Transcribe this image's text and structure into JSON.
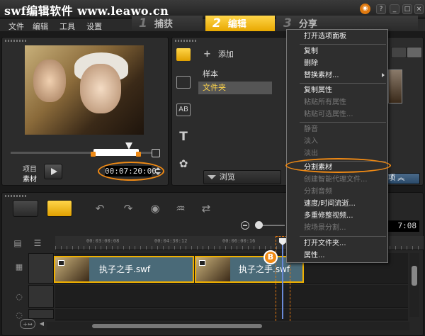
{
  "window": {
    "title": "swf编辑软件 www.leawo.cn"
  },
  "menu": {
    "items": [
      "文件",
      "编辑",
      "工具",
      "设置"
    ]
  },
  "steps": [
    {
      "num": "1",
      "label": "捕获"
    },
    {
      "num": "2",
      "label": "编辑"
    },
    {
      "num": "3",
      "label": "分享"
    }
  ],
  "player": {
    "labels": {
      "project": "项目",
      "clip": "素材"
    },
    "timecode": "00:07:20:00"
  },
  "library": {
    "add_label": "添加",
    "items": [
      {
        "label": "样本"
      },
      {
        "label": "文件夹"
      }
    ],
    "browse_label": "浏览",
    "options_label": "选项"
  },
  "timeline": {
    "ruler": [
      "00:03:00:08",
      "00:04:30:12",
      "00:06:00:16"
    ],
    "duration_text": "7:08",
    "clips": [
      {
        "label": "执子之手.swf"
      },
      {
        "label": "执子之手.swf"
      }
    ],
    "marker_label": "B"
  },
  "context_menu": {
    "items": [
      {
        "label": "打开选项面板",
        "enabled": true
      },
      {
        "label": "复制",
        "enabled": true
      },
      {
        "label": "删除",
        "enabled": true
      },
      {
        "label": "替换素材...",
        "enabled": true,
        "submenu": true
      },
      {
        "label": "复制属性",
        "enabled": true
      },
      {
        "label": "粘贴所有属性",
        "enabled": false
      },
      {
        "label": "粘贴可选属性...",
        "enabled": false
      },
      {
        "label": "静音",
        "enabled": false
      },
      {
        "label": "淡入",
        "enabled": false
      },
      {
        "label": "淡出",
        "enabled": false
      },
      {
        "label": "分割素材",
        "enabled": true,
        "highlighted": true
      },
      {
        "label": "创建智能代理文件...",
        "enabled": false
      },
      {
        "label": "分割音频",
        "enabled": false
      },
      {
        "label": "速度/时间流逝...",
        "enabled": true
      },
      {
        "label": "多重修整视频...",
        "enabled": true
      },
      {
        "label": "按场景分割...",
        "enabled": false
      },
      {
        "label": "打开文件夹...",
        "enabled": true
      },
      {
        "label": "属性...",
        "enabled": true
      }
    ]
  },
  "colors": {
    "accent": "#f08a14",
    "step_active": "#ffd54a",
    "playhead": "#6a8ad8"
  }
}
